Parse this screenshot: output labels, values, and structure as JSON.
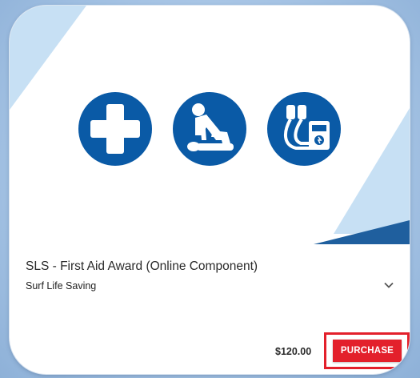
{
  "course": {
    "title": "SLS - First Aid Award (Online Component)",
    "provider": "Surf Life Saving",
    "price": "$120.00",
    "purchase_label": "PURCHASE"
  },
  "banner": {
    "icons": [
      "first-aid-cross-icon",
      "cpr-icon",
      "defibrillator-icon"
    ]
  },
  "colors": {
    "icon_blue": "#0a5aa6",
    "stripe_light_blue": "#c7e0f4",
    "stripe_dark_blue": "#1f5f9e",
    "purchase_red": "#e3202b",
    "background_blue": "#a9c6e6"
  },
  "icons": {
    "expand": "chevron-down-icon"
  }
}
